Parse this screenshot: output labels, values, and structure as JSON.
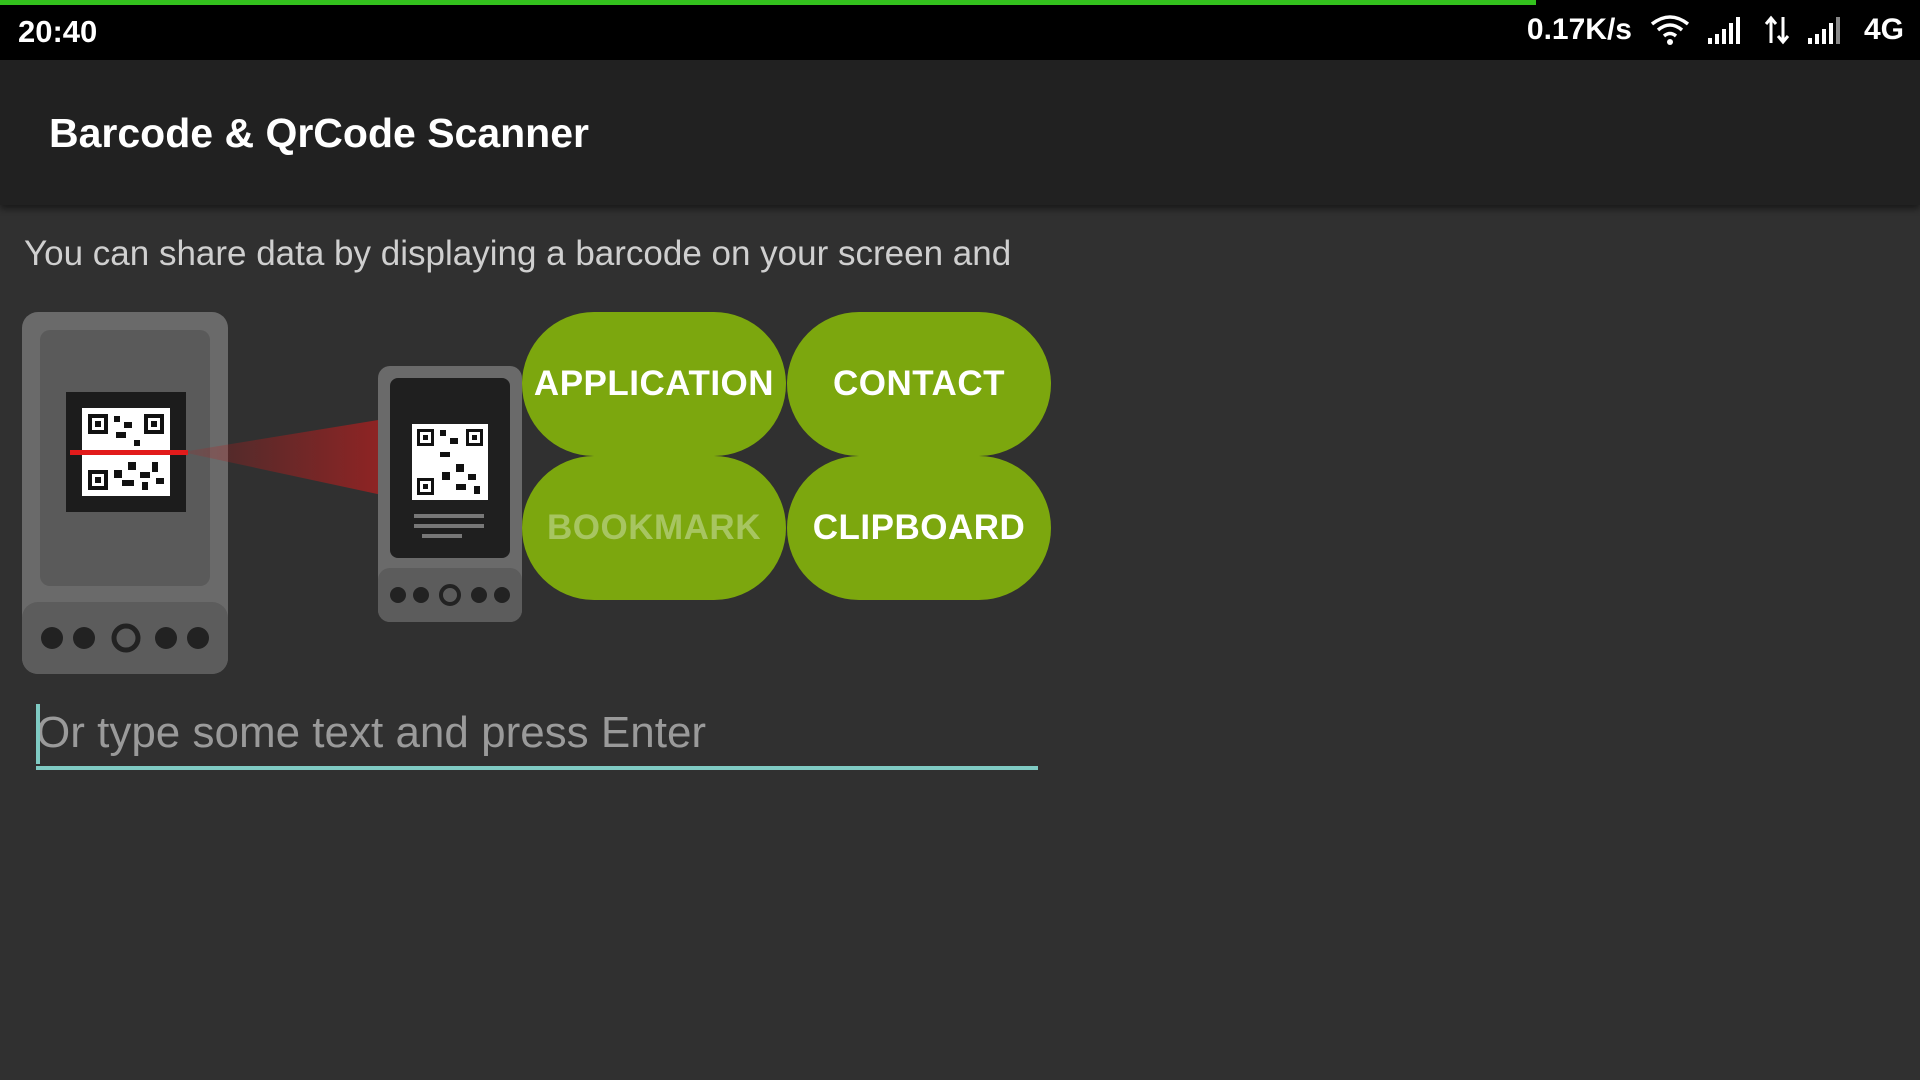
{
  "status_bar": {
    "time": "20:40",
    "speed": "0.17K/s",
    "network": "4G",
    "progress_fraction": 0.8,
    "progress_color": "#33c11d",
    "icons": [
      "wifi-icon",
      "signal-icon",
      "data-transfer-icon",
      "signal-icon"
    ]
  },
  "action_bar": {
    "title": "Barcode & QrCode Scanner"
  },
  "main": {
    "intro": "You can share data by displaying a barcode on your screen and",
    "buttons": {
      "application": "APPLICATION",
      "contact": "CONTACT",
      "bookmark": "BOOKMARK",
      "clipboard": "CLIPBOARD"
    },
    "input": {
      "placeholder": "Or type some text and press Enter",
      "value": ""
    },
    "accent_color": "#7ca70e",
    "input_line_color": "#7fcac3"
  }
}
